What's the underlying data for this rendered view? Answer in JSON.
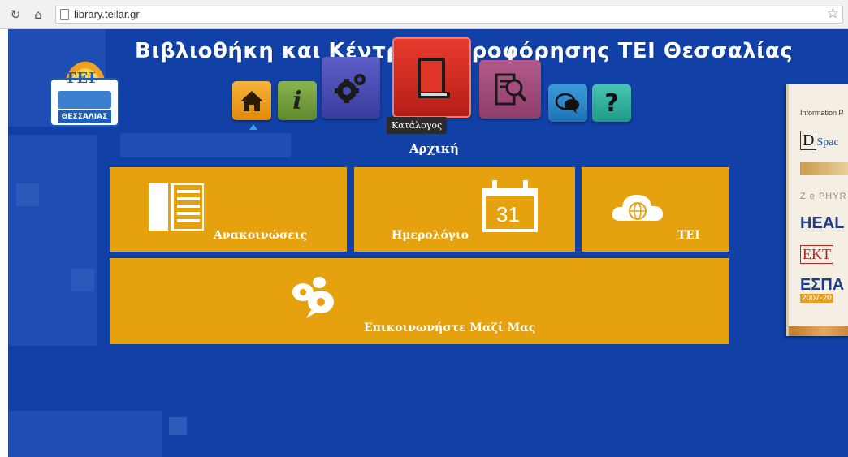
{
  "browser": {
    "reload_icon": "reload-icon",
    "home_icon": "home-icon",
    "url": "library.teilar.gr",
    "star_icon": "star-icon"
  },
  "site": {
    "title": "Βιβλιοθήκη και Κέντρο Πληροφόρησης ΤΕΙ Θεσσαλίας",
    "logo_text": "ΤΕΙ",
    "logo_label": "ΘΕΣΣΑΛΙΑΣ"
  },
  "nav": {
    "items": [
      {
        "name": "home",
        "icon": "home-icon",
        "color": "#e08a0a"
      },
      {
        "name": "info",
        "icon": "info-icon",
        "color": "#5f8a2c"
      },
      {
        "name": "settings",
        "icon": "gear-icon",
        "color": "#3a3c9c"
      },
      {
        "name": "catalog",
        "icon": "book-icon",
        "color": "#b51f16"
      },
      {
        "name": "search",
        "icon": "document-search-icon",
        "color": "#8f3d6a"
      },
      {
        "name": "chat",
        "icon": "chat-bubbles-icon",
        "color": "#1f73b8"
      },
      {
        "name": "help",
        "icon": "question-icon",
        "color": "#1e9a88"
      }
    ],
    "tooltip": "Κατάλογος"
  },
  "main": {
    "heading": "Αρχική",
    "tiles": {
      "announcements": "Ανακοινώσεις",
      "calendar": "Ημερολόγιο",
      "calendar_day": "31",
      "tei": "ΤΕΙ",
      "contact": "Επικοινωνήστε Μαζί Μας"
    }
  },
  "side_panel": {
    "items": {
      "information": "Information P",
      "dspace_letter": "D",
      "dspace": "Spac",
      "zephyr": "Z e PHYR",
      "heal": "HEAL",
      "ekt": "EKT",
      "espa": "ΕΣΠΑ",
      "espa_years": "2007-20"
    }
  },
  "colors": {
    "background": "#1140a6",
    "tile": "#e6a20e",
    "text": "#ffffff"
  }
}
